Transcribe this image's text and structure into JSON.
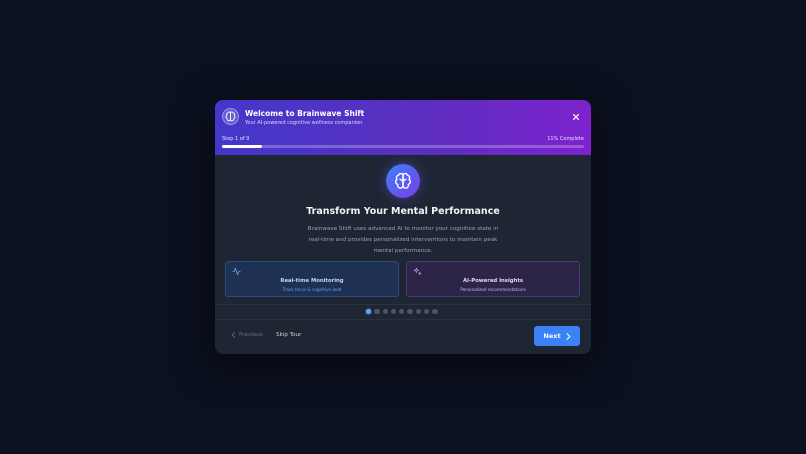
{
  "header": {
    "title": "Welcome to Brainwave Shift",
    "subtitle": "Your AI-powered cognitive wellness companion",
    "step_text": "Step 1 of 9",
    "percent_text": "11% Complete",
    "progress_fraction": 0.11
  },
  "content": {
    "icon": "brain-icon",
    "heading": "Transform Your Mental Performance",
    "description": "Brainwave Shift uses advanced AI to monitor your cognitive state in real-time and provides personalized interventions to maintain peak mental performance."
  },
  "features": [
    {
      "icon": "activity-icon",
      "title": "Real-time Monitoring",
      "subtitle": "Track focus & cognitive load",
      "accent": "#3b82f6"
    },
    {
      "icon": "sparkles-icon",
      "title": "AI-Powered Insights",
      "subtitle": "Personalized recommendations",
      "accent": "#a855f7"
    }
  ],
  "pagination": {
    "total": 9,
    "current": 1
  },
  "footer": {
    "previous_label": "Previous",
    "skip_label": "Skip Tour",
    "next_label": "Next"
  },
  "colors": {
    "background": "#0c1120",
    "modal": "#1e2533",
    "header_gradient_start": "#4338ca",
    "header_gradient_end": "#7e22ce",
    "primary": "#3b82f6"
  }
}
